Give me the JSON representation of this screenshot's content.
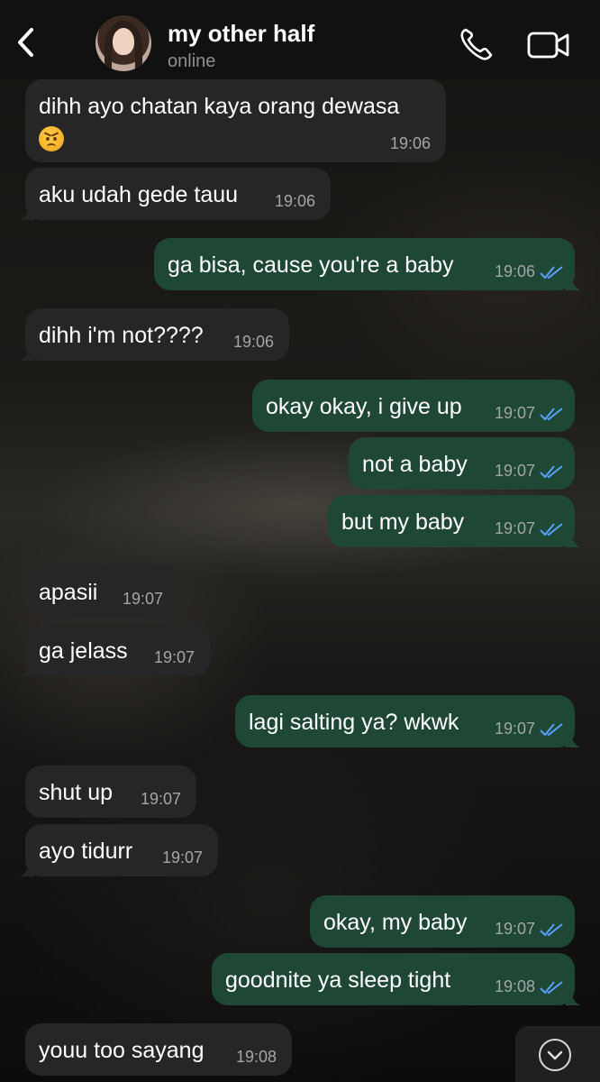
{
  "header": {
    "contact_name": "my other half",
    "status": "online",
    "back_icon": "chevron-left-icon",
    "call_icon": "phone-icon",
    "video_icon": "video-camera-icon"
  },
  "colors": {
    "incoming_bubble": "#262626",
    "outgoing_bubble": "#1f4735",
    "read_ticks": "#5aa0ff"
  },
  "messages": [
    {
      "dir": "in",
      "text": "dihh ayo chatan kaya orang dewasa",
      "emoji": "angry-face-emoji",
      "time": "19:06"
    },
    {
      "dir": "in",
      "text": "aku udah gede tauu",
      "time": "19:06"
    },
    {
      "dir": "out",
      "text": "ga bisa, cause you're a baby",
      "time": "19:06",
      "read": true
    },
    {
      "dir": "in",
      "text": "dihh i'm not????",
      "time": "19:06"
    },
    {
      "dir": "out",
      "text": "okay okay, i give up",
      "time": "19:07",
      "read": true
    },
    {
      "dir": "out",
      "text": "not a baby",
      "time": "19:07",
      "read": true
    },
    {
      "dir": "out",
      "text": "but my baby",
      "time": "19:07",
      "read": true
    },
    {
      "dir": "in",
      "text": "apasii",
      "time": "19:07"
    },
    {
      "dir": "in",
      "text": "ga jelass",
      "time": "19:07"
    },
    {
      "dir": "out",
      "text": "lagi salting ya? wkwk",
      "time": "19:07",
      "read": true
    },
    {
      "dir": "in",
      "text": "shut up",
      "time": "19:07"
    },
    {
      "dir": "in",
      "text": "ayo tidurr",
      "time": "19:07"
    },
    {
      "dir": "out",
      "text": "okay, my baby",
      "time": "19:07",
      "read": true
    },
    {
      "dir": "out",
      "text": "goodnite ya sleep tight",
      "time": "19:08",
      "read": true
    },
    {
      "dir": "in",
      "text": "youu too sayang",
      "time": "19:08"
    }
  ],
  "scroll_button_icon": "chevron-down-circle-icon"
}
